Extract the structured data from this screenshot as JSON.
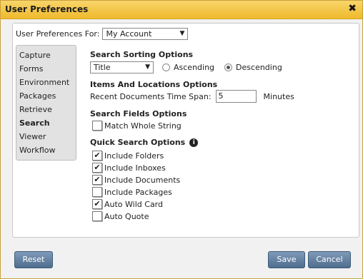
{
  "dialog": {
    "title": "User Preferences",
    "close_icon": "close-icon"
  },
  "header": {
    "pref_for_label": "User Preferences For:",
    "account_value": "My Account"
  },
  "sidebar": {
    "items": [
      {
        "label": "Capture"
      },
      {
        "label": "Forms"
      },
      {
        "label": "Environment"
      },
      {
        "label": "Packages"
      },
      {
        "label": "Retrieve"
      },
      {
        "label": "Search"
      },
      {
        "label": "Viewer"
      },
      {
        "label": "Workflow"
      }
    ],
    "active": "Search"
  },
  "search_sorting": {
    "title": "Search Sorting Options",
    "sort_field": "Title",
    "ascending_label": "Ascending",
    "descending_label": "Descending",
    "selected": "Descending"
  },
  "items_locations": {
    "title": "Items And Locations Options",
    "recent_label": "Recent Documents Time Span:",
    "recent_value": "5",
    "unit": "Minutes"
  },
  "search_fields": {
    "title": "Search Fields Options",
    "match_whole_label": "Match Whole String",
    "match_whole_checked": false
  },
  "quick_search": {
    "title": "Quick Search Options",
    "info_icon": "info-icon",
    "options": [
      {
        "label": "Include Folders",
        "checked": true
      },
      {
        "label": "Include Inboxes",
        "checked": true
      },
      {
        "label": "Include Documents",
        "checked": true
      },
      {
        "label": "Include Packages",
        "checked": false
      },
      {
        "label": "Auto Wild Card",
        "checked": true
      },
      {
        "label": "Auto Quote",
        "checked": false
      }
    ]
  },
  "buttons": {
    "reset": "Reset",
    "save": "Save",
    "cancel": "Cancel"
  }
}
